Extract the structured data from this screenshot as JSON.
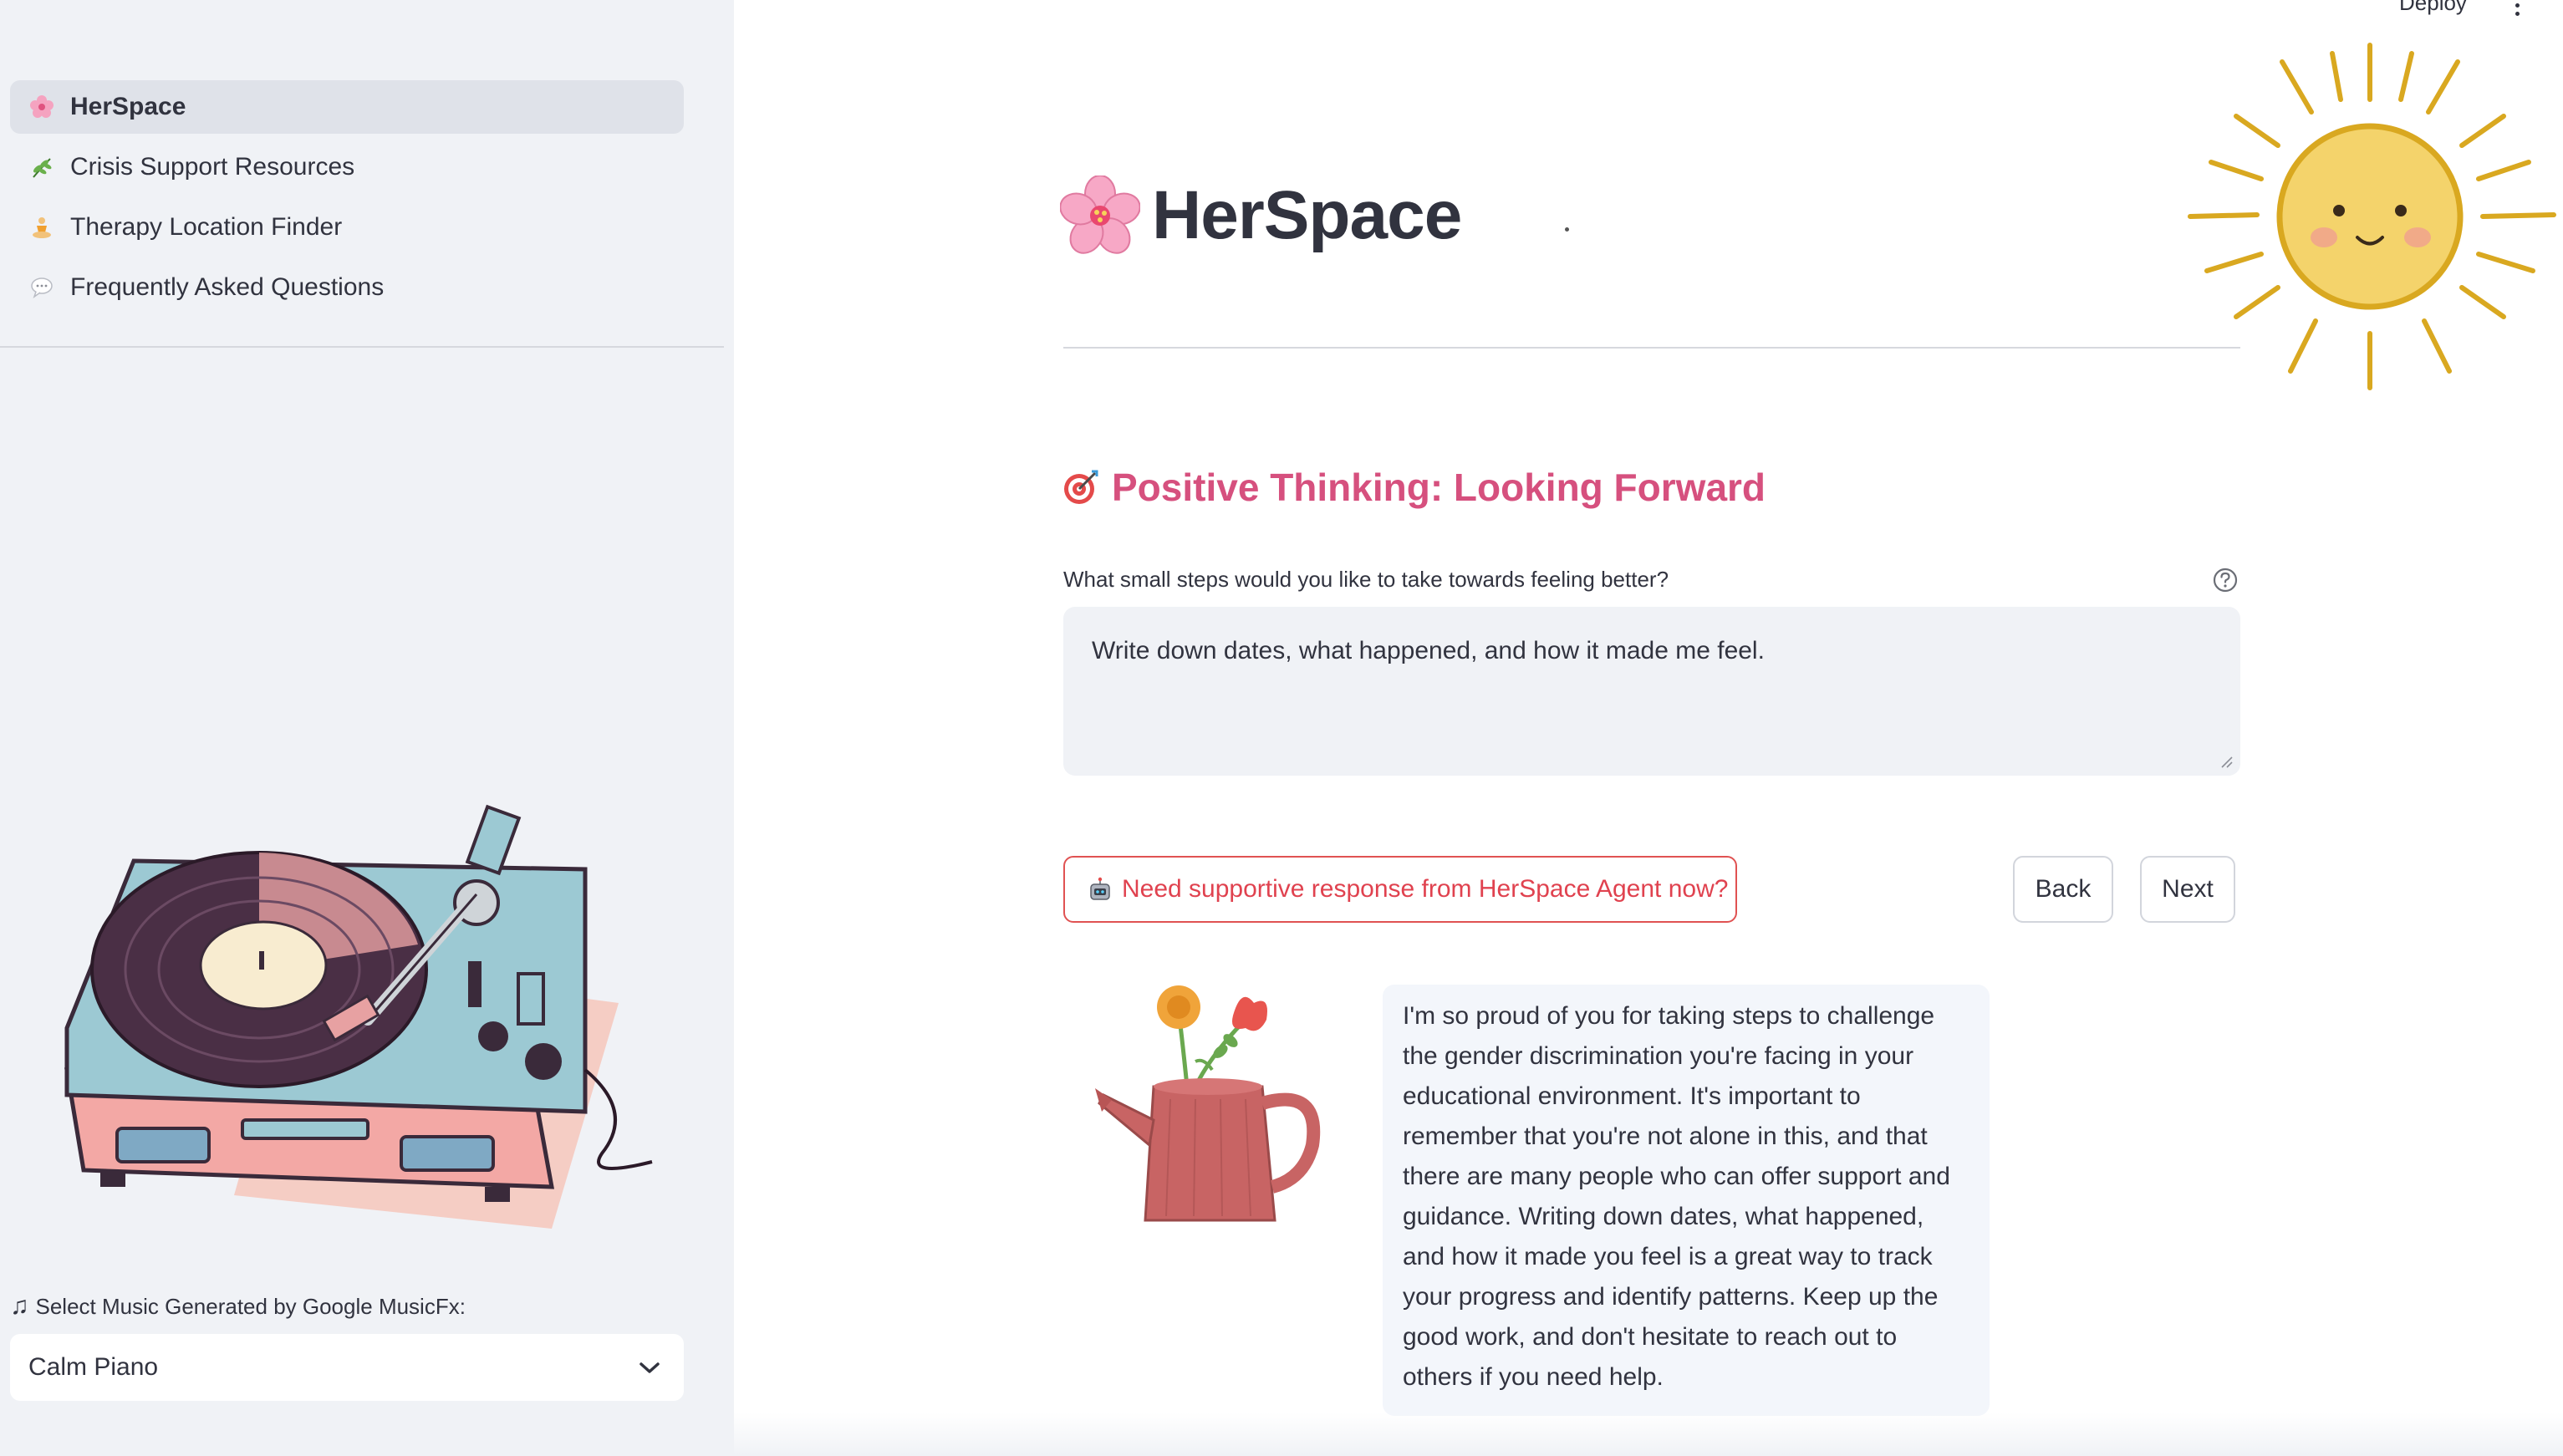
{
  "topbar": {
    "deploy_label": "Deploy"
  },
  "sidebar": {
    "nav": [
      {
        "label": "HerSpace",
        "icon": "cherry-blossom-icon",
        "active": true
      },
      {
        "label": "Crisis Support Resources",
        "icon": "herb-icon",
        "active": false
      },
      {
        "label": "Therapy Location Finder",
        "icon": "person-meditating-icon",
        "active": false
      },
      {
        "label": "Frequently Asked Questions",
        "icon": "speech-bubble-icon",
        "active": false
      }
    ],
    "music": {
      "label": "Select Music Generated by Google MusicFx:",
      "selected": "Calm Piano"
    }
  },
  "main": {
    "title": "HerSpace",
    "section_title": "Positive Thinking: Looking Forward",
    "question": "What small steps would you like to take towards feeling better?",
    "answer": "Write down dates, what happened, and how it made me feel.",
    "agent_button": "Need supportive response from HerSpace Agent now?",
    "back_button": "Back",
    "next_button": "Next",
    "response": "I'm so proud of you for taking steps to challenge the gender discrimination you're facing in your educational environment. It's important to remember that you're not alone in this, and that there are many people who can offer support and guidance. Writing down dates, what happened, and how it made you feel is a great way to track your progress and identify patterns. Keep up the good work, and don't hesitate to reach out to others if you need help."
  },
  "colors": {
    "sidebar_bg": "#f0f2f6",
    "accent_pink": "#d6507e",
    "agent_red": "#e0424f",
    "text": "#31333f"
  }
}
